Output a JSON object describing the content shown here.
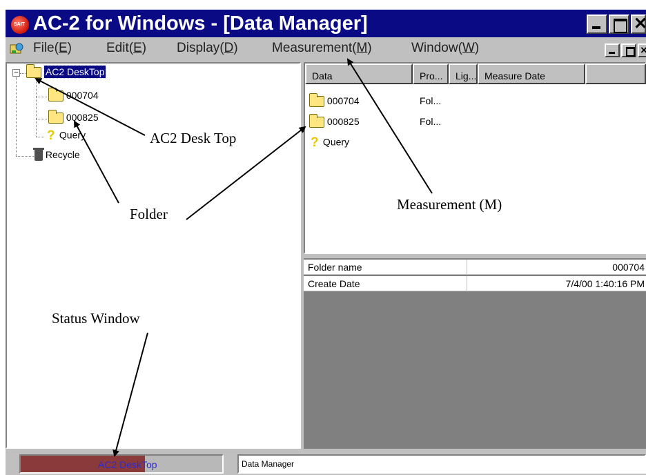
{
  "window": {
    "app_icon_text": "SAIT",
    "title": "AC-2 for Windows - [Data Manager]",
    "caption_close_glyph": "✕",
    "mdi_close_glyph": "×"
  },
  "menu": {
    "items": [
      {
        "label": "File",
        "key": "E"
      },
      {
        "label": "Edit",
        "key": "E"
      },
      {
        "label": "Display",
        "key": "D"
      },
      {
        "label": "Measurement",
        "key": "M"
      },
      {
        "label": "Window",
        "key": "W"
      }
    ]
  },
  "tree": {
    "expander_glyph": "−",
    "root": "AC2 DeskTop",
    "items": [
      "000704",
      "000825",
      "Query",
      "Recycle"
    ]
  },
  "list": {
    "columns": [
      "Data",
      "Pro...",
      "Lig...",
      "Measure Date"
    ],
    "rows": [
      {
        "name": "000704",
        "pro": "Fol..."
      },
      {
        "name": "000825",
        "pro": "Fol..."
      },
      {
        "name": "Query",
        "pro": ""
      }
    ]
  },
  "properties": [
    {
      "key": "Folder name",
      "value": "000704"
    },
    {
      "key": "Create Date",
      "value": "7/4/00 1:40:16 PM"
    }
  ],
  "status": {
    "left": "AC2 DeskTop",
    "right": "Data Manager"
  },
  "annotations": {
    "desk_top": "AC2 Desk Top",
    "folder": "Folder",
    "measurement": "Measurement (M)",
    "status_window": "Status Window"
  },
  "icons": {
    "folder": "folder-icon",
    "query": "question-mark-icon",
    "recycle": "trash-can-icon",
    "app": "app-logo-icon",
    "menu": "data-manager-icon"
  }
}
